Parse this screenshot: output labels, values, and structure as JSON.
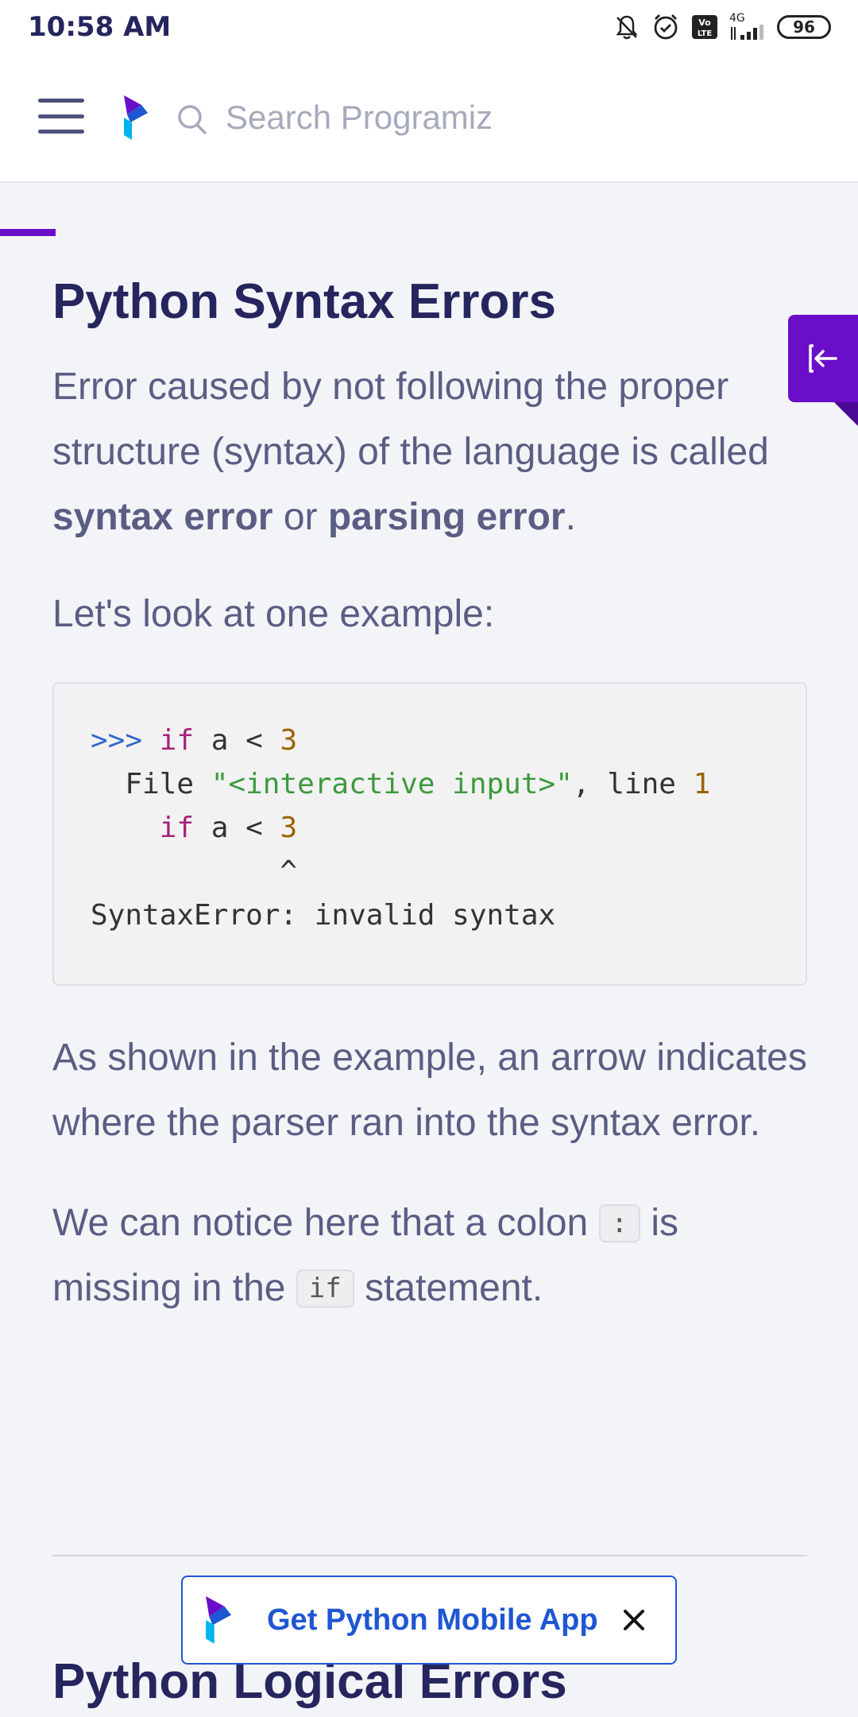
{
  "status_bar": {
    "time": "10:58 AM",
    "network_label": "4G",
    "battery": "96",
    "icons": [
      "bell-muted-icon",
      "alarm-icon",
      "volte-icon",
      "signal-icon",
      "battery-icon"
    ]
  },
  "nav": {
    "search_placeholder": "Search Programiz",
    "reading_progress_fraction": 0.065,
    "brand_colors": {
      "purple": "#6a0ec9",
      "blue": "#1f56d3",
      "accent": "#00b4f0"
    }
  },
  "article": {
    "title": "Python Syntax Errors",
    "intro": {
      "text1": "Error caused by not following the proper structure (syntax) of the language is called ",
      "bold1": "syntax error",
      "text2": " or ",
      "bold2": "parsing error",
      "text3": "."
    },
    "example_intro": "Let's look at one example:",
    "code": {
      "line1_prompt": ">>> ",
      "line1_kw": "if",
      "line1_rest": " a < ",
      "line1_num": "3",
      "line2_indent": "  File ",
      "line2_str": "\"<interactive input>\"",
      "line2_mid": ", line ",
      "line2_num": "1",
      "line3_indent": "    ",
      "line3_kw": "if",
      "line3_rest": " a < ",
      "line3_num": "3",
      "line4": "           ^",
      "line5": "SyntaxError: invalid syntax"
    },
    "explanation": "As shown in the example, an arrow indicates where the parser ran into the syntax error.",
    "colon_note": {
      "part1": "We can notice here that a colon ",
      "code1": ":",
      "part2": " is missing in the ",
      "code2": "if",
      "part3": " statement."
    },
    "next_title": "Python Logical Errors"
  },
  "banner": {
    "label": "Get Python Mobile App"
  },
  "side_tab": {
    "icon": "exit-panel-icon"
  }
}
